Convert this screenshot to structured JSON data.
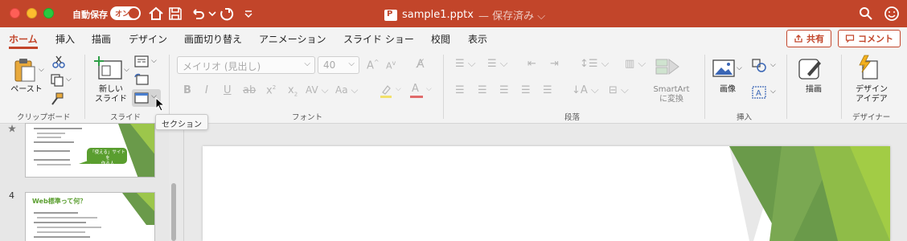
{
  "titlebar": {
    "autosave_label": "自動保存",
    "toggle_label": "オン",
    "filename": "sample1.pptx",
    "saved_status": "— 保存済み ⌵"
  },
  "tabs": [
    "ホーム",
    "挿入",
    "描画",
    "デザイン",
    "画面切り替え",
    "アニメーション",
    "スライド ショー",
    "校閲",
    "表示"
  ],
  "share_label": "共有",
  "comment_label": "コメント",
  "ribbon": {
    "paste_label": "ペースト",
    "clipboard_group": "クリップボード",
    "new_slide_label_1": "新しい",
    "new_slide_label_2": "スライド",
    "slides_group": "スライド",
    "font_name": "メイリオ (見出し)",
    "font_size": "40",
    "font_group": "フォント",
    "paragraph_group": "段落",
    "smartart_label_1": "SmartArt",
    "smartart_label_2": "に変換",
    "image_label": "画像",
    "insert_group": "挿入",
    "draw_label": "描画",
    "designer_label_1": "デザイン",
    "designer_label_2": "アイデア",
    "designer_group": "デザイナー"
  },
  "tooltip": "セクション",
  "slides": [
    {
      "num": "",
      "callout": "「使える」サイトを\n作る人"
    },
    {
      "num": "4",
      "title": "Web標準って何？"
    }
  ],
  "colors": {
    "accent": "#c2452a",
    "green": "#5a9e2f",
    "lightgreen": "#9cc64b"
  }
}
